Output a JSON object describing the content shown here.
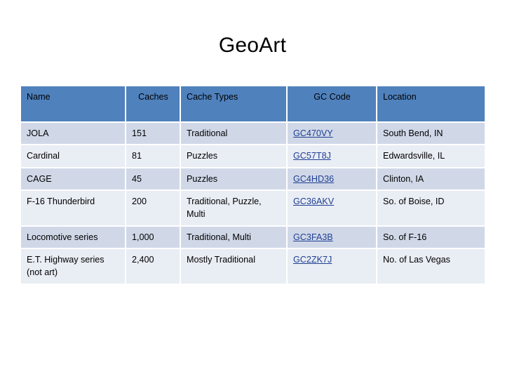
{
  "slide": {
    "title": "GeoArt",
    "theme": {
      "header_bg": "#4f81bd",
      "header_text": "#ffffff",
      "row_band_dark": "#d0d8e8",
      "row_band_light": "#e9edf4",
      "link_color": "#1f3f94",
      "page_bg": "#ffffff"
    }
  },
  "table": {
    "columns": [
      {
        "key": "name",
        "label": "Name",
        "align": "left"
      },
      {
        "key": "caches",
        "label": "Caches",
        "align": "right"
      },
      {
        "key": "cache_types",
        "label": "Cache Types",
        "align": "left"
      },
      {
        "key": "gc_code",
        "label": "GC Code",
        "align": "center"
      },
      {
        "key": "location",
        "label": "Location",
        "align": "left"
      }
    ],
    "rows": [
      {
        "name": "JOLA",
        "caches": "151",
        "cache_types": "Traditional",
        "gc_code": "GC470VY",
        "location": "South Bend, IN"
      },
      {
        "name": "Cardinal",
        "caches": "81",
        "cache_types": "Puzzles",
        "gc_code": "GC57T8J",
        "location": "Edwardsville, IL"
      },
      {
        "name": "CAGE",
        "caches": "45",
        "cache_types": "Puzzles",
        "gc_code": "GC4HD36",
        "location": "Clinton, IA"
      },
      {
        "name": "F-16 Thunderbird",
        "caches": "200",
        "cache_types": "Traditional, Puzzle, Multi",
        "gc_code": "GC36AKV",
        "location": "So. of Boise, ID"
      },
      {
        "name": "Locomotive series",
        "caches": "1,000",
        "cache_types": "Traditional,  Multi",
        "gc_code": "GC3FA3B",
        "location": "So. of F-16"
      },
      {
        "name": "E.T. Highway series (not art)",
        "caches": "2,400",
        "cache_types": "Mostly Traditional",
        "gc_code": "GC2ZK7J",
        "location": "No. of Las Vegas"
      }
    ]
  }
}
